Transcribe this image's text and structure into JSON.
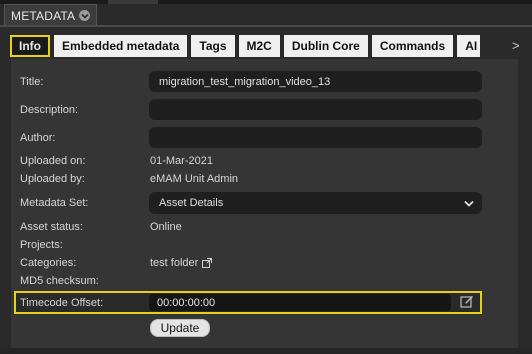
{
  "panel": {
    "title": "METADATA"
  },
  "tabs": [
    {
      "label": "Info"
    },
    {
      "label": "Embedded metadata"
    },
    {
      "label": "Tags"
    },
    {
      "label": "M2C"
    },
    {
      "label": "Dublin Core"
    },
    {
      "label": "Commands"
    },
    {
      "label": "AI"
    }
  ],
  "tabs_more": ">",
  "fields": {
    "title": {
      "label": "Title:",
      "value": "migration_test_migration_video_13"
    },
    "description": {
      "label": "Description:",
      "value": ""
    },
    "author": {
      "label": "Author:",
      "value": ""
    },
    "uploaded_on": {
      "label": "Uploaded on:",
      "value": "01-Mar-2021"
    },
    "uploaded_by": {
      "label": "Uploaded by:",
      "value": "eMAM Unit Admin"
    },
    "metadata_set": {
      "label": "Metadata Set:",
      "value": "Asset Details"
    },
    "asset_status": {
      "label": "Asset status:",
      "value": "Online"
    },
    "projects": {
      "label": "Projects:",
      "value": ""
    },
    "categories": {
      "label": "Categories:",
      "value": "test folder"
    },
    "md5": {
      "label": "MD5 checksum:",
      "value": ""
    },
    "timecode": {
      "label": "Timecode Offset:",
      "value": "00:00:00:00"
    }
  },
  "update_label": "Update",
  "colors": {
    "highlight": "#e6d21c",
    "background": "#2a2a2a",
    "panel": "#353535"
  },
  "icons": [
    "chevron-down-icon",
    "external-link-icon",
    "edit-icon",
    "dropdown-chevron-icon"
  ]
}
